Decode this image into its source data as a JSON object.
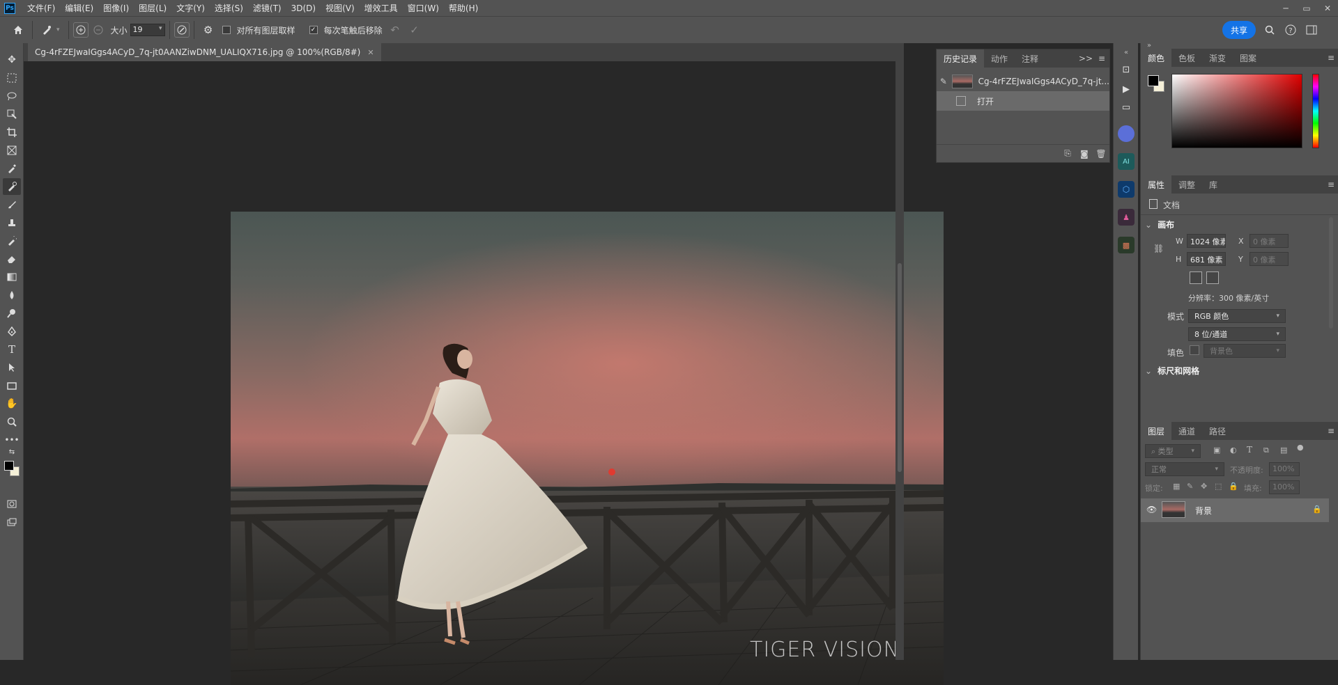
{
  "app": {
    "logo": "Ps"
  },
  "menu": [
    "文件(F)",
    "编辑(E)",
    "图像(I)",
    "图层(L)",
    "文字(Y)",
    "选择(S)",
    "滤镜(T)",
    "3D(D)",
    "视图(V)",
    "增效工具",
    "窗口(W)",
    "帮助(H)"
  ],
  "window_controls": {
    "minimize": "─",
    "restore": "▭",
    "close": "✕"
  },
  "options": {
    "size_label": "大小",
    "size_value": "19",
    "sample_all_label": "对所有图层取样",
    "sample_all_checked": false,
    "remove_after_label": "每次笔触后移除",
    "remove_after_checked": true,
    "share_label": "共享"
  },
  "document": {
    "tab_title": "Cg-4rFZEJwaIGgs4ACyD_7q-jt0AANZiwDNM_UALIQX716.jpg @ 100%(RGB/8#)",
    "close": "✕",
    "watermark": "TIGER VISION"
  },
  "history_panel": {
    "tabs": [
      "历史记录",
      "动作",
      "注释"
    ],
    "active_tab": 0,
    "snapshot_label": "Cg-4rFZEJwaIGgs4ACyD_7q-jt...",
    "items": [
      "打开"
    ],
    "more": ">>"
  },
  "color_panel": {
    "tabs": [
      "颜色",
      "色板",
      "渐变",
      "图案"
    ],
    "foreground": "#000000",
    "background": "#f5f0d8",
    "hue_accent": "#e00000"
  },
  "properties_panel": {
    "tabs": [
      "属性",
      "调整",
      "库"
    ],
    "doc_label": "文档",
    "canvas_header": "画布",
    "w_label": "W",
    "w_value": "1024 像素",
    "h_label": "H",
    "h_value": "681 像素",
    "x_label": "X",
    "x_placeholder": "0 像素",
    "y_label": "Y",
    "y_placeholder": "0 像素",
    "resolution": "分辨率：300 像素/英寸",
    "mode_label": "模式",
    "mode_value": "RGB 颜色",
    "depth_value": "8 位/通道",
    "fill_label": "填色",
    "fill_value": "背景色",
    "rulers_header": "标尺和网格"
  },
  "layers_panel": {
    "tabs": [
      "图层",
      "通道",
      "路径"
    ],
    "filter_placeholder": "类型",
    "blend_mode": "正常",
    "opacity_label": "不透明度:",
    "opacity_value": "100%",
    "lock_label": "锁定:",
    "fill_label": "填充:",
    "fill_value": "100%",
    "layers": [
      {
        "name": "背景",
        "visible": true,
        "locked": true
      }
    ]
  }
}
